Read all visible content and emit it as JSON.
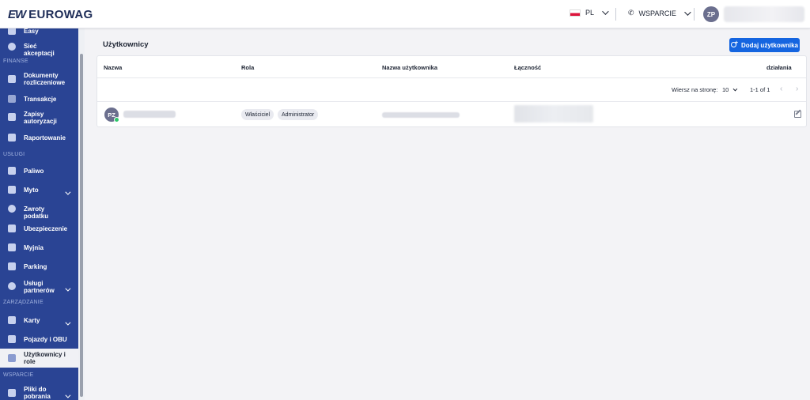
{
  "header": {
    "logo_mark": "EW",
    "logo_text": "EUROWAG",
    "language": "PL",
    "support_label": "WSPARCIE",
    "user_initials": "ZP"
  },
  "sidebar": {
    "items": [
      {
        "label": "Easy",
        "icon": "wallet-icon"
      },
      {
        "label": "Sieć akceptacji",
        "icon": "map-pin-icon"
      },
      {
        "label": "Dokumenty rozliczeniowe",
        "icon": "document-icon"
      },
      {
        "label": "Transakcje",
        "icon": "transfer-arrows-icon"
      },
      {
        "label": "Zapisy autoryzacji",
        "icon": "receipt-icon"
      },
      {
        "label": "Raportowanie",
        "icon": "report-icon"
      },
      {
        "label": "Paliwo",
        "icon": "fuel-pump-icon"
      },
      {
        "label": "Myto",
        "icon": "toll-gate-icon"
      },
      {
        "label": "Zwroty podatku",
        "icon": "tax-refund-icon"
      },
      {
        "label": "Ubezpieczenie",
        "icon": "insurance-icon"
      },
      {
        "label": "Myjnia",
        "icon": "car-wash-icon"
      },
      {
        "label": "Parking",
        "icon": "parking-icon"
      },
      {
        "label": "Usługi partnerów",
        "icon": "handshake-icon"
      },
      {
        "label": "Karty",
        "icon": "card-icon"
      },
      {
        "label": "Pojazdy i OBU",
        "icon": "truck-icon"
      },
      {
        "label": "Użytkownicy i role",
        "icon": "users-icon"
      },
      {
        "label": "Pliki do pobrania",
        "icon": "download-icon"
      }
    ],
    "sections": [
      "FINANSE",
      "USŁUGI",
      "ZARZĄDZANIE",
      "WSPARCIE"
    ]
  },
  "main": {
    "title": "Użytkownicy",
    "add_button": "Dodaj użytkownika",
    "table": {
      "columns": [
        "Nazwa",
        "Rola",
        "Nazwa użytkownika",
        "Łączność",
        "działania"
      ],
      "rows_per_page_label": "Wiersz na stronę:",
      "rows_per_page": "10",
      "range": "1-1 of 1",
      "rows": [
        {
          "initials": "PZ",
          "roles": [
            "Właściciel",
            "Administrator"
          ]
        }
      ]
    }
  }
}
